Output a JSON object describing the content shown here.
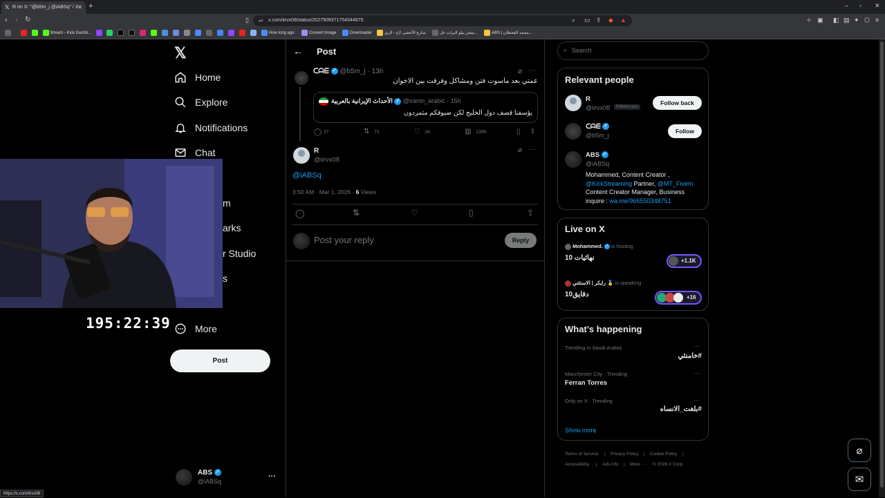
{
  "browser": {
    "tab_title": "R on X: \"@b5m_j @iABSq\" / X",
    "url": "x.com/iirvx08/status/2027909371754344875",
    "status_url": "https://x.com/iirvx08",
    "bookmarks": [
      "Stream - Kick Dashb...",
      "How long ago",
      "Convert Image",
      "Downloader",
      "شارع الأعشى 2ج - الري...",
      "متجر بيلو البرات عل...",
      "ABS | محمد القحطان..."
    ]
  },
  "sidebar": {
    "items": [
      {
        "label": "Home",
        "icon": "home-icon"
      },
      {
        "label": "Explore",
        "icon": "search-icon"
      },
      {
        "label": "Notifications",
        "icon": "bell-icon"
      },
      {
        "label": "Chat",
        "icon": "mail-icon"
      },
      {
        "label": "m",
        "icon": ""
      },
      {
        "label": "arks",
        "icon": ""
      },
      {
        "label": "r Studio",
        "icon": ""
      },
      {
        "label": "s",
        "icon": ""
      },
      {
        "label": "More",
        "icon": "more-circle-icon"
      }
    ],
    "post_button": "Post",
    "account": {
      "name": "ABS",
      "handle": "@iABSq"
    }
  },
  "overlay": {
    "timer": "195:22:39"
  },
  "main": {
    "header_title": "Post",
    "parent_post": {
      "author_name": "ᑕᗩᗴ",
      "handle": "@b5m_j",
      "time": "13h",
      "text": "عمتي بعد ماسوت فتن ومشاكل وفرقت بين الاخوان",
      "quote": {
        "author_name": "الأحداث الإيرانية بالعربية",
        "handle": "@iranin_arabic",
        "time": "15h",
        "text": "يؤسفنا قصف دول الخليج لكن ضيوفكم متمردون"
      },
      "stats": {
        "replies": "27",
        "reposts": "71",
        "likes": "1K",
        "views": "136K"
      }
    },
    "reply_post": {
      "author_name": "R",
      "handle": "@iirvx08",
      "mention": "@iABSq",
      "timestamp": "3:50 AM · Mar 1, 2026 · ",
      "views_count": "6",
      "views_label": " Views"
    },
    "compose": {
      "placeholder": "Post your reply",
      "button": "Reply"
    }
  },
  "right": {
    "search_placeholder": "Search",
    "relevant_people": {
      "title": "Relevant people",
      "people": [
        {
          "name": "R",
          "handle": "@iirvx08",
          "follows_you": "Follows you",
          "button": "Follow back"
        },
        {
          "name": "ᑕᗩᗴ",
          "handle": "@b5m_j",
          "button": "Follow"
        },
        {
          "name": "ABS",
          "handle": "@iABSq",
          "bio_prefix": "Mohammed, Content Creator ,",
          "bio_link1": "@KickStreaming",
          "bio_mid": " Partner, ",
          "bio_link2": "@MT_Fivem",
          "bio_line3": "Content Creator Manager, Business",
          "bio_line4_prefix": "inquire : ",
          "bio_link3": "wa.me/966550348751"
        }
      ]
    },
    "live": {
      "title": "Live on X",
      "items": [
        {
          "host": "Mohammed.",
          "status": "is hosting",
          "title": "نهائيات 10",
          "count": "+1.1K"
        },
        {
          "host": "رايكر | الاستثني 🥇",
          "status": "is speaking",
          "title": "دقايق10",
          "count": "+16"
        }
      ]
    },
    "happening": {
      "title": "What’s happening",
      "items": [
        {
          "context": "Trending in Saudi Arabia",
          "topic": "#خامنئي"
        },
        {
          "context": "Manchester City · Trending",
          "topic": "Ferran Torres"
        },
        {
          "context": "Only on X · Trending",
          "topic": "#بلغت_الانساه"
        }
      ],
      "show_more": "Show more"
    },
    "footer": [
      "Terms of Service",
      "Privacy Policy",
      "Cookie Policy",
      "Accessibility",
      "Ads info",
      "More ···",
      "© 2026 X Corp."
    ]
  },
  "colors": {
    "accent": "#1d9bf0",
    "background": "#000000",
    "border": "#2f3336",
    "muted": "#71767b"
  }
}
